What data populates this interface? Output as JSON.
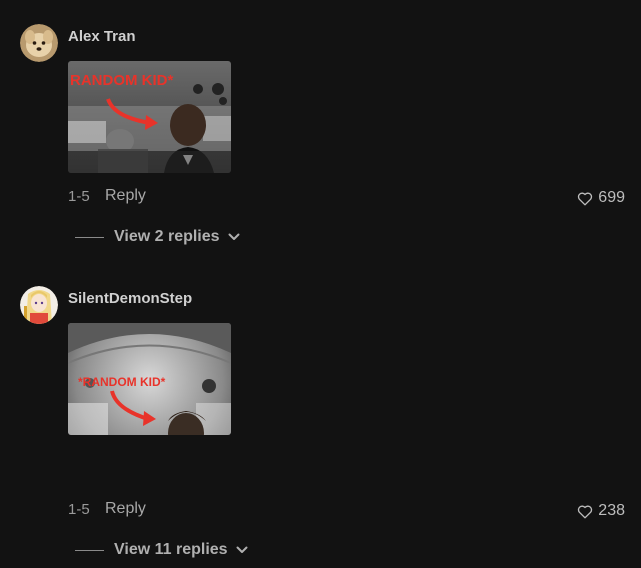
{
  "comments": [
    {
      "username": "Alex Tran",
      "image_caption": "RANDOM KID*",
      "date": "1-5",
      "reply_label": "Reply",
      "likes": "699",
      "view_replies_label": "View 2 replies"
    },
    {
      "username": "SilentDemonStep",
      "image_caption": "*RANDOM KID*",
      "date": "1-5",
      "reply_label": "Reply",
      "likes": "238",
      "view_replies_label": "View 11 replies"
    }
  ],
  "colors": {
    "background": "#121212",
    "caption_red": "#e8332a"
  },
  "icons": {
    "like": "heart-outline-icon",
    "expand": "chevron-down-icon"
  }
}
